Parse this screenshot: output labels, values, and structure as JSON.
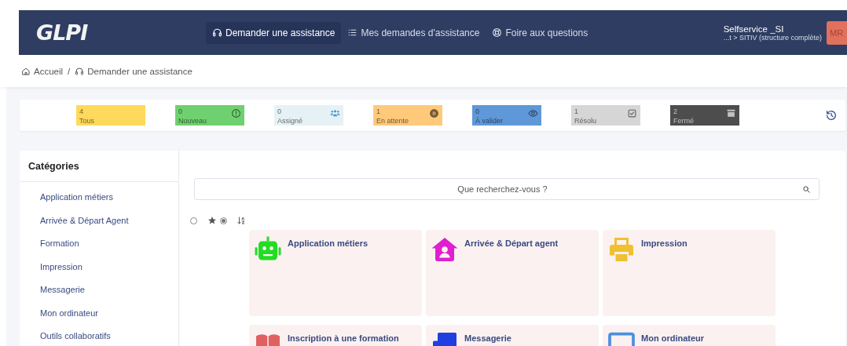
{
  "header": {
    "logo": "GLPI",
    "nav": [
      {
        "label": "Demander une assistance",
        "kind": "headset",
        "selected": true
      },
      {
        "label": "Mes demandes d'assistance",
        "kind": "list",
        "selected": false
      },
      {
        "label": "Foire aux questions",
        "kind": "lifebuoy",
        "selected": false
      }
    ],
    "user": {
      "name": "Selfservice _SI",
      "entity": "...t > SITIV (structure complète)",
      "initials": "MR"
    }
  },
  "breadcrumb": {
    "items": [
      {
        "label": "Accueil",
        "kind": "home"
      },
      {
        "label": "Demander une assistance",
        "kind": "headset"
      }
    ],
    "separator": "/"
  },
  "status_tiles": [
    {
      "count": "4",
      "label": "Tous",
      "kind": "all",
      "color": "#ffd95c"
    },
    {
      "count": "0",
      "label": "Nouveau",
      "kind": "new",
      "color": "#6fd06f"
    },
    {
      "count": "0",
      "label": "Assigné",
      "kind": "assigned",
      "color": "#e6f1f5"
    },
    {
      "count": "1",
      "label": "En attente",
      "kind": "waiting",
      "color": "#ffc97a"
    },
    {
      "count": "0",
      "label": "À valider",
      "kind": "validate",
      "color": "#5f98d8"
    },
    {
      "count": "1",
      "label": "Résolu",
      "kind": "solved",
      "color": "#d6d6d6"
    },
    {
      "count": "2",
      "label": "Fermé",
      "kind": "closed",
      "color": "#4d4d4d"
    }
  ],
  "sidebar": {
    "title": "Catégories",
    "items": [
      "Application métiers",
      "Arrivée & Départ Agent",
      "Formation",
      "Impression",
      "Messagerie",
      "Mon ordinateur",
      "Outils collaboratifs"
    ]
  },
  "content": {
    "search": {
      "placeholder": "Que recherchez-vous ?"
    },
    "view_options": [
      {
        "kind": "all",
        "selected": false
      },
      {
        "kind": "favorites",
        "selected": true
      }
    ],
    "cards": [
      {
        "title": "Application métiers",
        "kind": "robot",
        "color": "#22dd22"
      },
      {
        "title": "Arrivée & Départ agent",
        "kind": "house-user",
        "color": "#e01fd0"
      },
      {
        "title": "Impression",
        "kind": "printer",
        "color": "#f0c030"
      },
      {
        "title": "Inscription à une formation",
        "kind": "book",
        "color": "#e06060"
      },
      {
        "title": "Messagerie",
        "kind": "envelopes",
        "color": "#1f3fe0"
      },
      {
        "title": "Mon ordinateur",
        "kind": "monitor",
        "color": "#4a90e0"
      }
    ]
  }
}
